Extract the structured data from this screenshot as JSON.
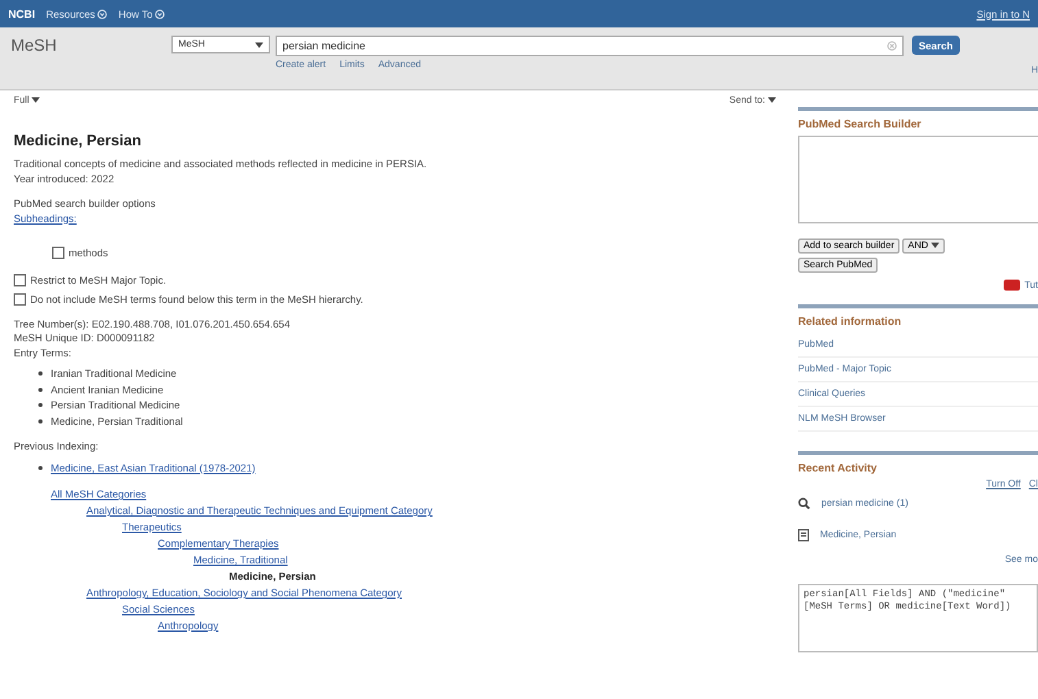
{
  "top_bar": {
    "brand": "NCBI",
    "links": [
      "Resources",
      "How To"
    ],
    "sign_in": "Sign in to N"
  },
  "search": {
    "database": "MeSH",
    "db_select": "MeSH",
    "query": "persian medicine",
    "button": "Search",
    "links": [
      "Create alert",
      "Limits",
      "Advanced"
    ],
    "help": "H"
  },
  "toolbar": {
    "format": "Full",
    "send_to": "Send to:"
  },
  "record": {
    "title": "Medicine, Persian",
    "description": "Traditional concepts of medicine and associated methods reflected in medicine in PERSIA.",
    "year": "Year introduced: 2022",
    "builder_options": "PubMed search builder options",
    "subheadings_link": "Subheadings:",
    "subheadings": [
      {
        "label": "methods",
        "checked": false
      }
    ],
    "options": [
      {
        "label": "Restrict to MeSH Major Topic.",
        "checked": false
      },
      {
        "label": "Do not include MeSH terms found below this term in the MeSH hierarchy.",
        "checked": false
      }
    ],
    "tree_numbers": "Tree Number(s): E02.190.488.708, I01.076.201.450.654.654",
    "unique_id": "MeSH Unique ID: D000091182",
    "entry_terms_label": "Entry Terms:",
    "entry_terms": [
      "Iranian Traditional Medicine",
      "Ancient Iranian Medicine",
      "Persian Traditional Medicine",
      "Medicine, Persian Traditional"
    ],
    "previous_indexing_label": "Previous Indexing:",
    "previous_indexing": [
      "Medicine, East Asian Traditional (1978-2021)"
    ],
    "tree": [
      {
        "label": "All MeSH Categories",
        "current": false,
        "children": [
          {
            "label": "Analytical, Diagnostic and Therapeutic Techniques and Equipment Category",
            "current": false,
            "children": [
              {
                "label": "Therapeutics",
                "current": false,
                "children": [
                  {
                    "label": "Complementary Therapies",
                    "current": false,
                    "children": [
                      {
                        "label": "Medicine, Traditional",
                        "current": false,
                        "children": [
                          {
                            "label": "Medicine, Persian",
                            "current": true
                          }
                        ]
                      }
                    ]
                  }
                ]
              }
            ]
          },
          {
            "label": "Anthropology, Education, Sociology and Social Phenomena Category",
            "current": false,
            "children": [
              {
                "label": "Social Sciences",
                "current": false,
                "children": [
                  {
                    "label": "Anthropology",
                    "current": false
                  }
                ]
              }
            ]
          }
        ]
      }
    ]
  },
  "sidebar": {
    "builder_title": "PubMed Search Builder",
    "add_button": "Add to search builder",
    "operator": "AND",
    "search_button": "Search PubMed",
    "tutorial": "Tut",
    "related_title": "Related information",
    "related": [
      "PubMed",
      "PubMed - Major Topic",
      "Clinical Queries",
      "NLM MeSH Browser"
    ],
    "recent_title": "Recent Activity",
    "recent_controls": [
      "Turn Off",
      "Cl"
    ],
    "recent": [
      {
        "kind": "search",
        "label": "persian medicine (1)"
      },
      {
        "kind": "record",
        "label": "Medicine, Persian"
      }
    ],
    "see_more": "See mo",
    "query_details": "persian[All Fields] AND (\"medicine\"[MeSH Terms] OR medicine[Text Word])"
  }
}
